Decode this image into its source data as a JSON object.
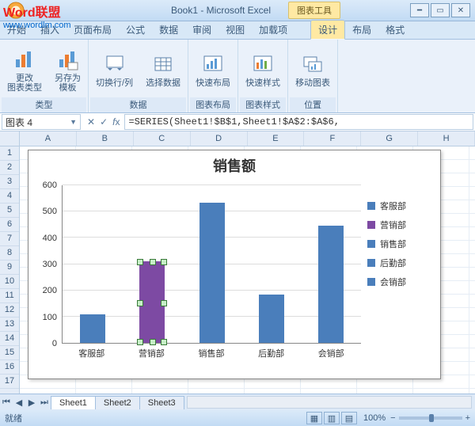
{
  "window": {
    "title": "Book1 - Microsoft Excel",
    "context_tool": "图表工具"
  },
  "tabs": [
    "开始",
    "插入",
    "页面布局",
    "公式",
    "数据",
    "审阅",
    "视图",
    "加载项"
  ],
  "ctx_tabs": [
    "设计",
    "布局",
    "格式"
  ],
  "active_ctx_tab": "设计",
  "ribbon": {
    "g1": {
      "label": "类型",
      "b1": "更改\n图表类型",
      "b2": "另存为\n模板"
    },
    "g2": {
      "label": "数据",
      "b1": "切换行/列",
      "b2": "选择数据"
    },
    "g3": {
      "label": "图表布局",
      "b1": "快速布局"
    },
    "g4": {
      "label": "图表样式",
      "b1": "快速样式"
    },
    "g5": {
      "label": "位置",
      "b1": "移动图表"
    }
  },
  "name_box": "图表 4",
  "formula": "=SERIES(Sheet1!$B$1,Sheet1!$A$2:$A$6,",
  "columns": [
    "A",
    "B",
    "C",
    "D",
    "E",
    "F",
    "G",
    "H"
  ],
  "row_count": 17,
  "chart_data": {
    "type": "bar",
    "title": "销售额",
    "categories": [
      "客服部",
      "营销部",
      "销售部",
      "后勤部",
      "会销部"
    ],
    "values": [
      110,
      310,
      535,
      185,
      445
    ],
    "selected_index": 1,
    "ylim": [
      0,
      600
    ],
    "ytick": 100,
    "legend": [
      "客服部",
      "营销部",
      "销售部",
      "后勤部",
      "会销部"
    ],
    "bar_color": "#4a7ebb",
    "selected_color": "#7d4aa3"
  },
  "sheets": [
    "Sheet1",
    "Sheet2",
    "Sheet3"
  ],
  "active_sheet": "Sheet1",
  "status": {
    "ready": "就绪",
    "zoom": "100%"
  },
  "watermark": {
    "line1": "Word联盟",
    "line2": "www.wordlm.com"
  }
}
